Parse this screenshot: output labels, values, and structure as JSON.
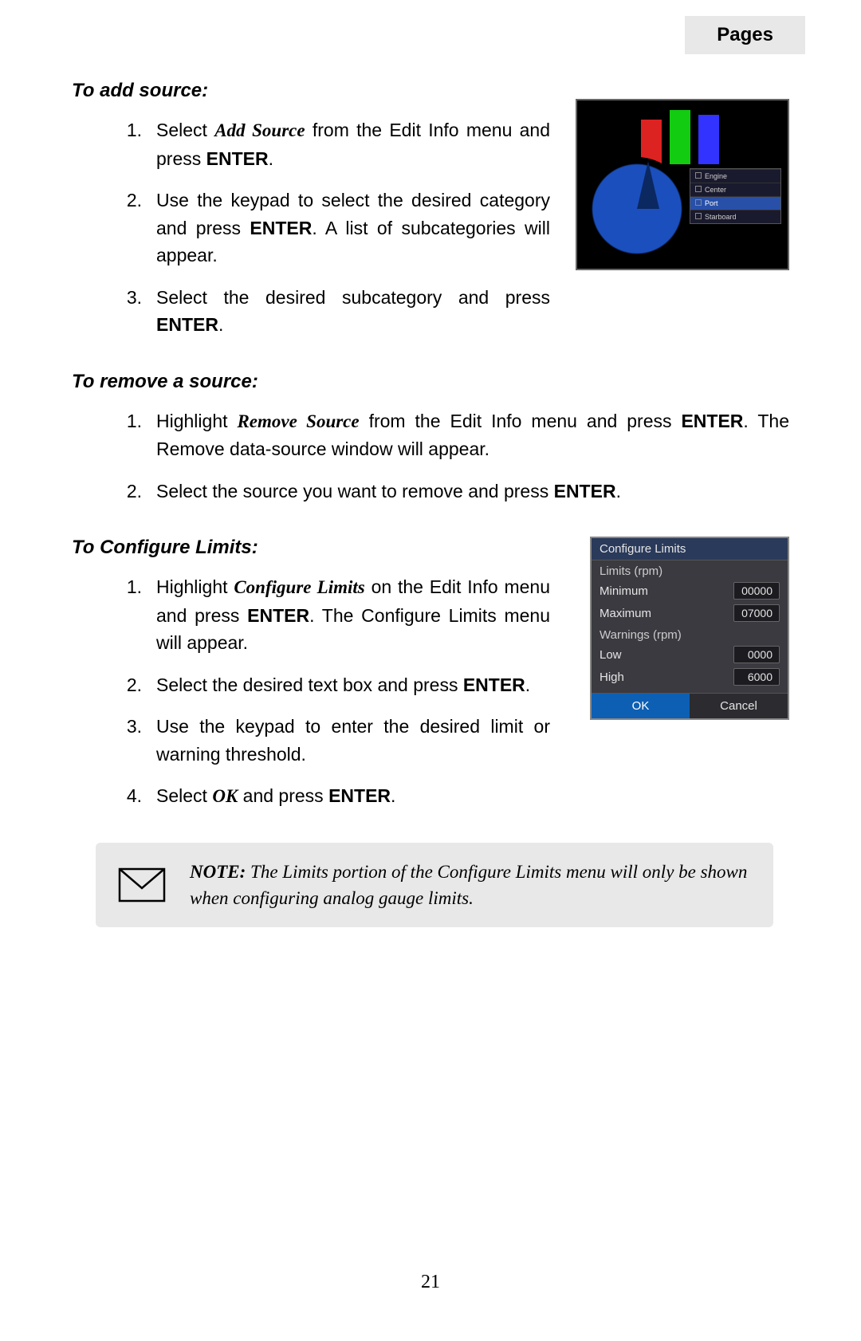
{
  "pageTab": "Pages",
  "pageNumber": "21",
  "sections": {
    "addSource": {
      "heading": "To add source:",
      "items": [
        {
          "num": "1.",
          "pre": "Select ",
          "emph": "Add Source",
          "mid": " from the Edit Info menu and press ",
          "bold": "ENTER",
          "post": "."
        },
        {
          "num": "2.",
          "text_a": "Use the keypad to select the desired category and press ",
          "bold": "ENTER",
          "text_b": ". A list of subcategories will appear."
        },
        {
          "num": "3.",
          "text_a": "Select the desired subcategory and press ",
          "bold": "ENTER",
          "text_b": "."
        }
      ]
    },
    "removeSource": {
      "heading": "To remove a source:",
      "items": [
        {
          "num": "1.",
          "pre": "Highlight ",
          "emph": "Remove Source",
          "mid": " from the Edit Info menu and press ",
          "bold": "ENTER",
          "post": ". The Remove data-source window will appear."
        },
        {
          "num": "2.",
          "text_a": "Select the source you want to remove and press ",
          "bold": "ENTER",
          "text_b": "."
        }
      ]
    },
    "configureLimits": {
      "heading": "To Configure Limits:",
      "items": [
        {
          "num": "1.",
          "pre": "Highlight ",
          "emph": "Configure Limits",
          "mid": " on the Edit Info menu and press ",
          "bold": "ENTER",
          "post": ". The Configure Limits menu will appear."
        },
        {
          "num": "2.",
          "text_a": "Select the desired text box and press ",
          "bold": "ENTER",
          "text_b": "."
        },
        {
          "num": "3.",
          "text_full": "Use the keypad to enter the desired limit or warning threshold."
        },
        {
          "num": "4.",
          "pre": "Select ",
          "emph": "OK",
          "mid": " and press ",
          "bold": "ENTER",
          "post": "."
        }
      ]
    }
  },
  "gaugeMenu": {
    "items": [
      "Engine",
      "Center",
      "Port",
      "Starboard"
    ],
    "selectedIndex": 2
  },
  "configDialog": {
    "title": "Configure Limits",
    "group1": "Limits (rpm)",
    "minLabel": "Minimum",
    "minVal": "00000",
    "maxLabel": "Maximum",
    "maxVal": "07000",
    "group2": "Warnings (rpm)",
    "lowLabel": "Low",
    "lowVal": "0000",
    "highLabel": "High",
    "highVal": "6000",
    "ok": "OK",
    "cancel": "Cancel"
  },
  "note": {
    "lead": "NOTE:",
    "body": " The Limits portion of the Configure Limits menu will only be shown when configuring analog gauge limits."
  }
}
